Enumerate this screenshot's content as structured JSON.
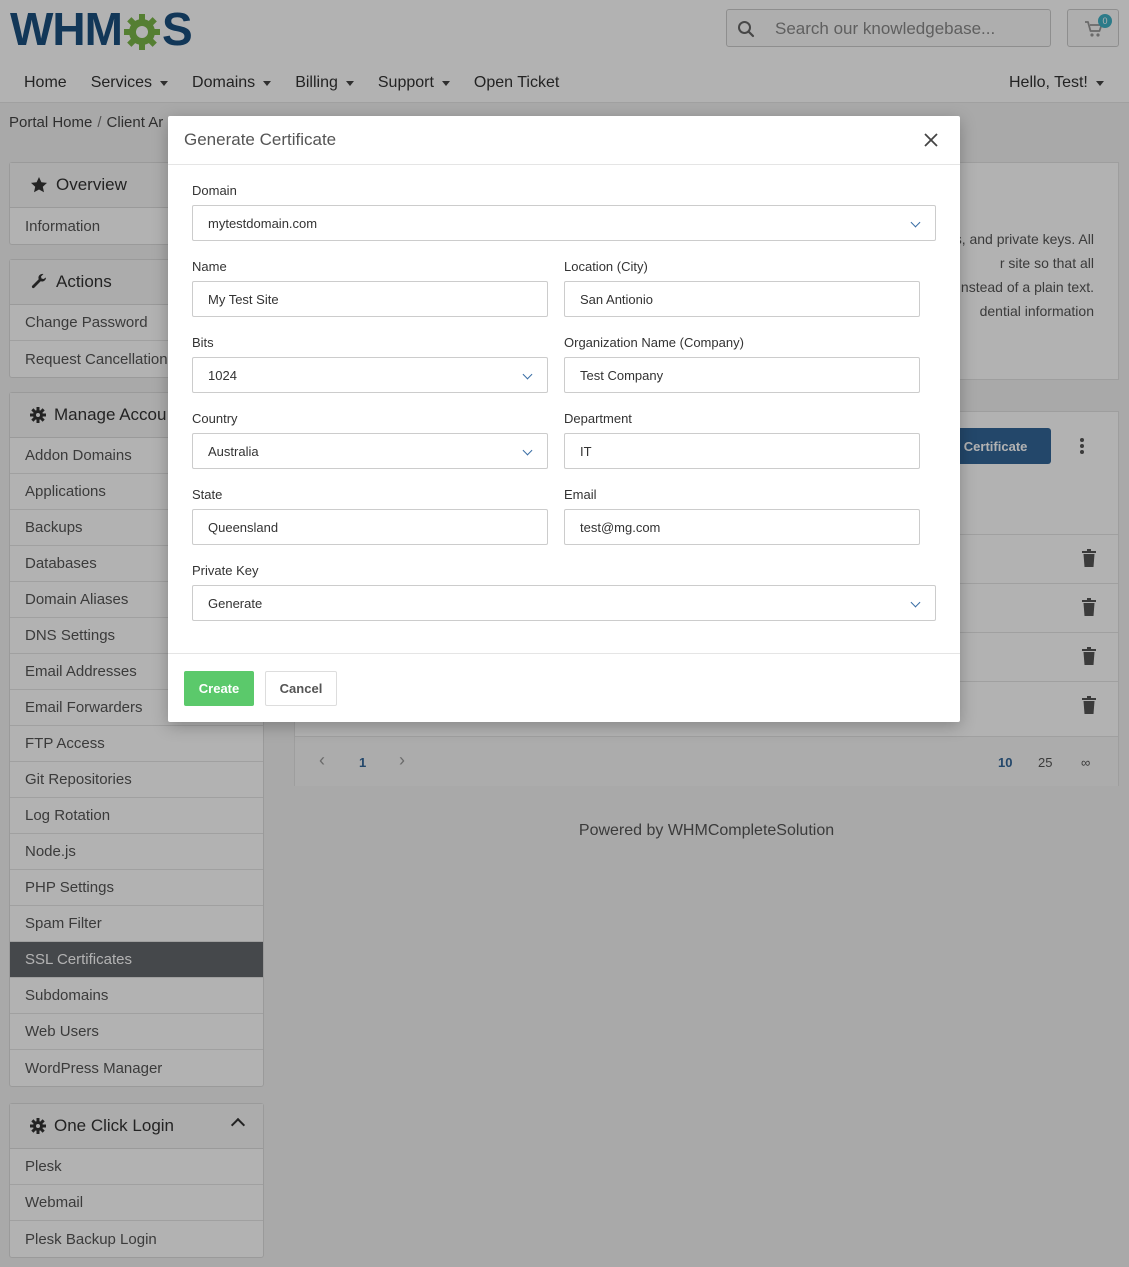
{
  "header": {
    "logo_text_left": "WHM",
    "logo_text_right": "S",
    "search_placeholder": "Search our knowledgebase...",
    "cart_count": "0",
    "nav": [
      {
        "label": "Home",
        "dropdown": false
      },
      {
        "label": "Services",
        "dropdown": true
      },
      {
        "label": "Domains",
        "dropdown": true
      },
      {
        "label": "Billing",
        "dropdown": true
      },
      {
        "label": "Support",
        "dropdown": true
      },
      {
        "label": "Open Ticket",
        "dropdown": false
      }
    ],
    "user_greeting": "Hello, Test!"
  },
  "breadcrumb": {
    "items": [
      "Portal Home",
      "Client Ar"
    ],
    "separator": "/"
  },
  "sidebar": {
    "overview": {
      "title": "Overview",
      "items": [
        "Information"
      ]
    },
    "actions": {
      "title": "Actions",
      "items": [
        "Change Password",
        "Request Cancellation"
      ]
    },
    "manage": {
      "title": "Manage Accou",
      "items": [
        "Addon Domains",
        "Applications",
        "Backups",
        "Databases",
        "Domain Aliases",
        "DNS Settings",
        "Email Addresses",
        "Email Forwarders",
        "FTP Access",
        "Git Repositories",
        "Log Rotation",
        "Node.js",
        "PHP Settings",
        "Spam Filter",
        "SSL Certificates",
        "Subdomains",
        "Web Users",
        "WordPress Manager"
      ],
      "active": "SSL Certificates"
    },
    "oneclick": {
      "title": "One Click Login",
      "items": [
        "Plesk",
        "Webmail",
        "Plesk Backup Login"
      ]
    }
  },
  "main": {
    "description_lines": [
      "s, and private keys. All",
      "r site so that all",
      "nstead of a plain text.",
      "dential information"
    ],
    "generate_button": "te Certificate",
    "pager": {
      "prev": "‹",
      "page": "1",
      "next": "›",
      "sizes": [
        "10",
        "25",
        "∞"
      ]
    },
    "footer": "Powered by WHMCompleteSolution"
  },
  "modal": {
    "title": "Generate Certificate",
    "fields": {
      "domain": {
        "label": "Domain",
        "value": "mytestdomain.com"
      },
      "name": {
        "label": "Name",
        "value": "My Test Site"
      },
      "location": {
        "label": "Location (City)",
        "value": "San Antionio"
      },
      "bits": {
        "label": "Bits",
        "value": "1024"
      },
      "organization": {
        "label": "Organization Name (Company)",
        "value": "Test Company"
      },
      "country": {
        "label": "Country",
        "value": "Australia"
      },
      "department": {
        "label": "Department",
        "value": "IT"
      },
      "state": {
        "label": "State",
        "value": "Queensland"
      },
      "email": {
        "label": "Email",
        "value": "test@mg.com"
      },
      "private_key": {
        "label": "Private Key",
        "value": "Generate"
      }
    },
    "create_button": "Create",
    "cancel_button": "Cancel"
  },
  "colors": {
    "brand_blue": "#1b4f7e",
    "brand_green": "#7ab648",
    "primary": "#336699",
    "success": "#5bc96b",
    "active_sidebar": "#63676c"
  }
}
